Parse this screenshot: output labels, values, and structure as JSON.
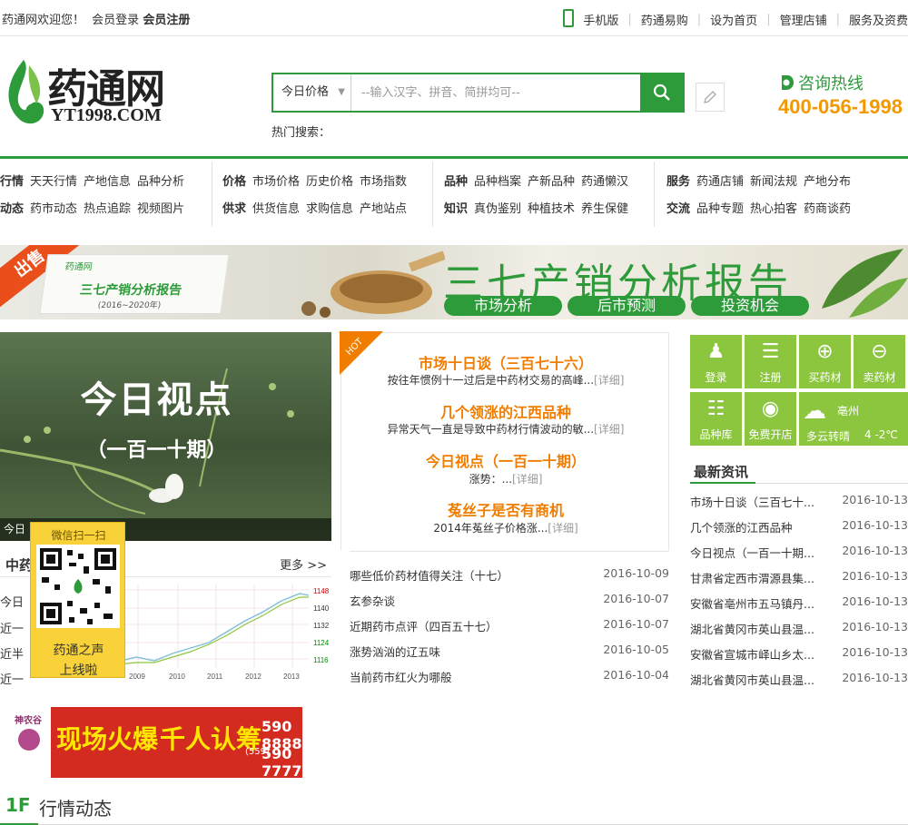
{
  "topbar": {
    "welcome": "药通网欢迎您！",
    "login": "会员登录",
    "register": "会员注册",
    "links": [
      "手机版",
      "药通易购",
      "设为首页",
      "管理店铺",
      "服务及资费"
    ]
  },
  "logo": {
    "cn": "药通网",
    "en": "YT1998.COM"
  },
  "search": {
    "select": "今日价格",
    "placeholder": "--输入汉字、拼音、简拼均可--",
    "hot_label": "热门搜索："
  },
  "hotline": {
    "label": "咨询热线",
    "number": "400-056-1998"
  },
  "nav": [
    {
      "rows": [
        {
          "head": "行情",
          "items": [
            "天天行情",
            "产地信息",
            "品种分析"
          ]
        },
        {
          "head": "动态",
          "items": [
            "药市动态",
            "热点追踪",
            "视频图片"
          ]
        }
      ]
    },
    {
      "rows": [
        {
          "head": "价格",
          "items": [
            "市场价格",
            "历史价格",
            "市场指数"
          ]
        },
        {
          "head": "供求",
          "items": [
            "供货信息",
            "求购信息",
            "产地站点"
          ]
        }
      ]
    },
    {
      "rows": [
        {
          "head": "品种",
          "items": [
            "品种档案",
            "产新品种",
            "药通懒汉"
          ]
        },
        {
          "head": "知识",
          "items": [
            "真伪鉴别",
            "种植技术",
            "养生保健"
          ]
        }
      ]
    },
    {
      "rows": [
        {
          "head": "服务",
          "items": [
            "药通店铺",
            "新闻法规",
            "产地分布"
          ]
        },
        {
          "head": "交流",
          "items": [
            "品种专题",
            "热心拍客",
            "药商谈药"
          ]
        }
      ]
    }
  ],
  "banner": {
    "corner": "出售",
    "book_title": "三七产销分析报告",
    "book_years": "(2016~2020年)",
    "book_brand": "药通网",
    "title": "三七产销分析报告",
    "pills": [
      "市场分析",
      "后市预测",
      "投资机会"
    ]
  },
  "viewpoint": {
    "headline": "今日视点",
    "issue": "（一百一十期）",
    "caption": "今日"
  },
  "qr": {
    "top": "微信扫一扫",
    "bottom1": "药通之声",
    "bottom2": "上线啦"
  },
  "price_chart": {
    "title": "中药",
    "more": "更多 >>",
    "rows": [
      "今日",
      "近一",
      "近半",
      "近一"
    ],
    "y_ticks": [
      "1148",
      "1140",
      "1132",
      "1124",
      "1116"
    ],
    "x_ticks": [
      "2009",
      "2010",
      "2011",
      "2012",
      "2013"
    ]
  },
  "hot": {
    "badge": "HOT",
    "items": [
      {
        "title": "市场十日谈（三百七十六）",
        "desc": "按往年惯例十一过后是中药材交易的高峰...",
        "detail": "[详细]"
      },
      {
        "title": "几个领涨的江西品种",
        "desc": "异常天气一直是导致中药材行情波动的敏...",
        "detail": "[详细]"
      },
      {
        "title": "今日视点（一百一十期）",
        "desc": "涨势：...",
        "detail": "[详细]"
      },
      {
        "title": "菟丝子是否有商机",
        "desc": "2014年菟丝子价格涨...",
        "detail": "[详细]"
      }
    ],
    "news": [
      {
        "title": "哪些低价药材值得关注（十七）",
        "date": "2016-10-09"
      },
      {
        "title": "玄参杂谈",
        "date": "2016-10-07"
      },
      {
        "title": "近期药市点评（四百五十七）",
        "date": "2016-10-07"
      },
      {
        "title": "涨势汹汹的辽五味",
        "date": "2016-10-05"
      },
      {
        "title": "当前药市红火为哪般",
        "date": "2016-10-04"
      }
    ]
  },
  "quick": [
    {
      "label": "登录",
      "icon": "user-icon"
    },
    {
      "label": "注册",
      "icon": "clipboard-icon"
    },
    {
      "label": "买药材",
      "icon": "cart-add-icon"
    },
    {
      "label": "卖药材",
      "icon": "cart-remove-icon"
    },
    {
      "label": "品种库",
      "icon": "tree-icon"
    },
    {
      "label": "免费开店",
      "icon": "location-icon"
    }
  ],
  "weather": {
    "city": "亳州",
    "desc": "多云转晴",
    "temp": "4 -2℃"
  },
  "latest": {
    "title": "最新资讯",
    "items": [
      {
        "title": "市场十日谈（三百七十...",
        "date": "2016-10-13"
      },
      {
        "title": "几个领涨的江西品种",
        "date": "2016-10-13"
      },
      {
        "title": "今日视点（一百一十期...",
        "date": "2016-10-13"
      },
      {
        "title": "甘肃省定西市渭源县集...",
        "date": "2016-10-13"
      },
      {
        "title": "安徽省亳州市五马镇丹...",
        "date": "2016-10-13"
      },
      {
        "title": "湖北省黄冈市英山县温...",
        "date": "2016-10-13"
      },
      {
        "title": "安徽省宣城市峄山乡太...",
        "date": "2016-10-13"
      },
      {
        "title": "湖北省黄冈市英山县温...",
        "date": "2016-10-13"
      }
    ]
  },
  "ad": {
    "brand": "神农谷",
    "text1": "现场火爆",
    "text2": "千人认筹",
    "phone1": "590 8888",
    "phone2": "590 7777",
    "area": "(559)"
  },
  "floor": {
    "num": "1F",
    "title": "行情动态"
  },
  "colors": {
    "green": "#2e9b3b",
    "orange": "#f07d00",
    "light_green": "#8cc63f",
    "hotline": "#f39800"
  }
}
